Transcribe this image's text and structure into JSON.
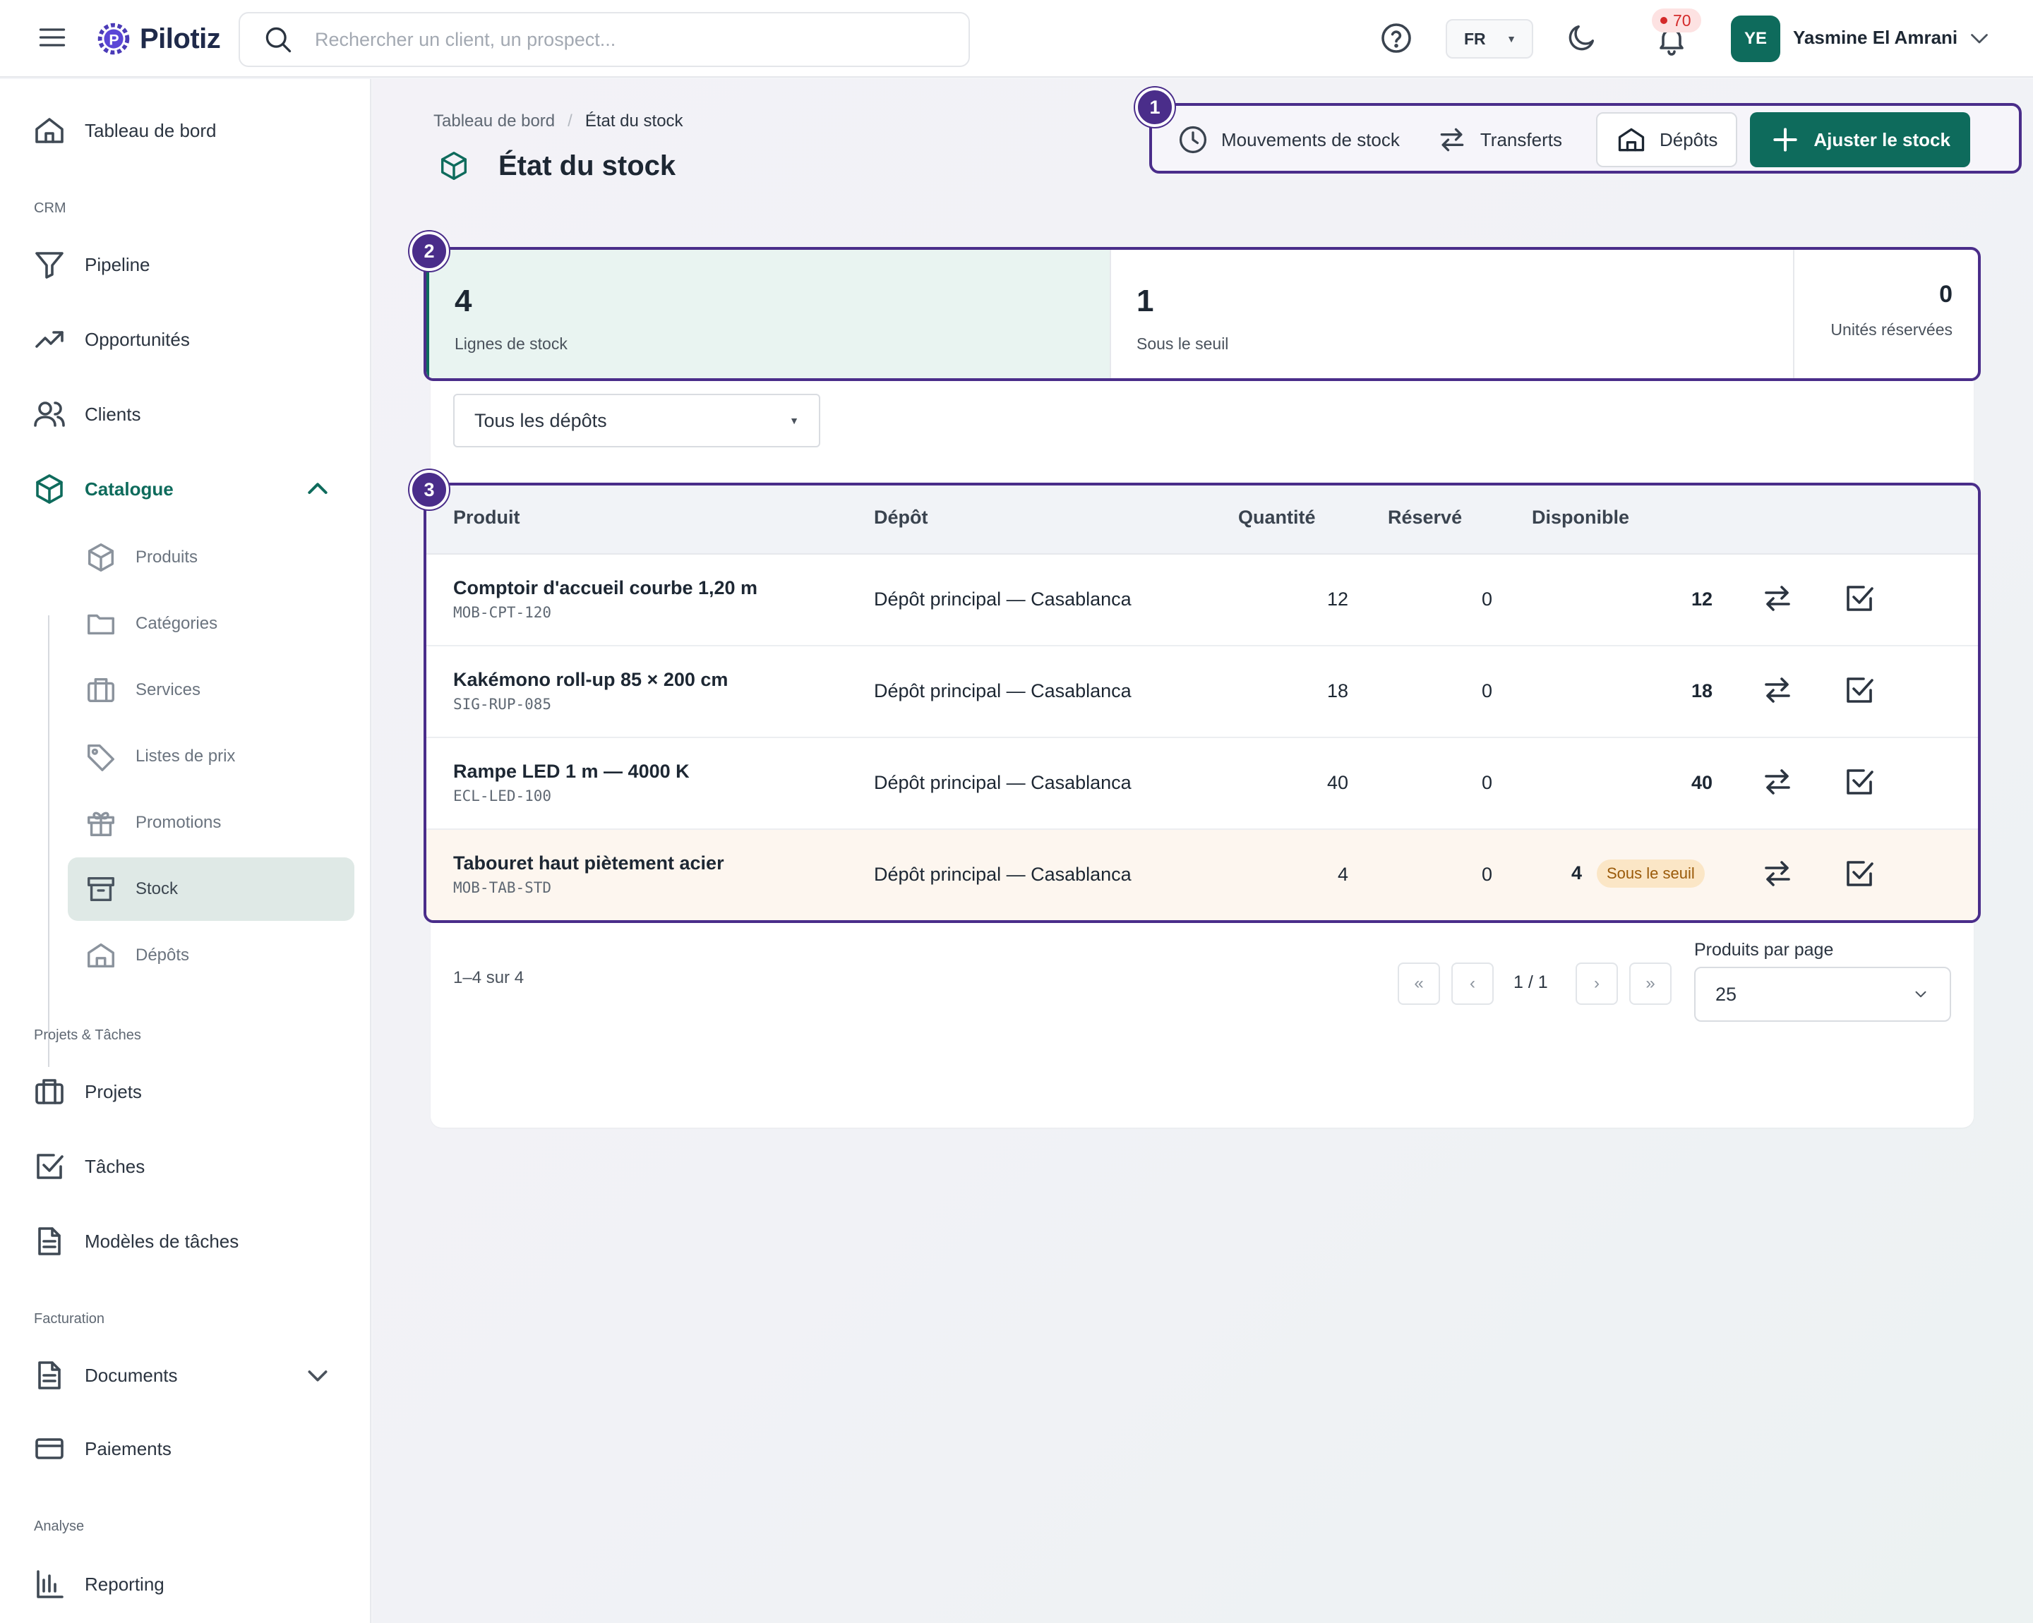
{
  "header": {
    "app_name": "Pilotiz",
    "search_placeholder": "Rechercher un client, un prospect...",
    "language": "FR",
    "notifications_count": "70",
    "user_initials": "YE",
    "user_name": "Yasmine El Amrani"
  },
  "sidebar": {
    "dashboard": "Tableau de bord",
    "sections": {
      "crm": "CRM",
      "projects": "Projets & Tâches",
      "billing": "Facturation",
      "analysis": "Analyse"
    },
    "crm_items": [
      "Pipeline",
      "Opportunités",
      "Clients"
    ],
    "catalogue": "Catalogue",
    "catalogue_items": [
      "Produits",
      "Catégories",
      "Services",
      "Listes de prix",
      "Promotions",
      "Stock",
      "Dépôts"
    ],
    "project_items": [
      "Projets",
      "Tâches",
      "Modèles de tâches"
    ],
    "billing_items": [
      "Documents",
      "Paiements"
    ],
    "analysis_items": [
      "Reporting"
    ]
  },
  "page": {
    "breadcrumb": [
      "Tableau de bord",
      "État du stock"
    ],
    "title": "État du stock"
  },
  "toolbar": {
    "movements": "Mouvements de stock",
    "transfers": "Transferts",
    "depots": "Dépôts",
    "adjust": "Ajuster le stock"
  },
  "markers": [
    "1",
    "2",
    "3"
  ],
  "stats": [
    {
      "value": "4",
      "label": "Lignes de stock"
    },
    {
      "value": "1",
      "label": "Sous le seuil"
    },
    {
      "value": "0",
      "label": "Unités réservées"
    }
  ],
  "filter": {
    "depot": "Tous les dépôts"
  },
  "table": {
    "columns": [
      "Produit",
      "Dépôt",
      "Quantité",
      "Réservé",
      "Disponible"
    ],
    "rows": [
      {
        "name": "Comptoir d'accueil courbe 1,20 m",
        "sku": "MOB-CPT-120",
        "depot": "Dépôt principal — Casablanca",
        "quantity": "12",
        "reserved": "0",
        "available": "12",
        "badge": ""
      },
      {
        "name": "Kakémono roll-up 85 × 200 cm",
        "sku": "SIG-RUP-085",
        "depot": "Dépôt principal — Casablanca",
        "quantity": "18",
        "reserved": "0",
        "available": "18",
        "badge": ""
      },
      {
        "name": "Rampe LED 1 m — 4000 K",
        "sku": "ECL-LED-100",
        "depot": "Dépôt principal — Casablanca",
        "quantity": "40",
        "reserved": "0",
        "available": "40",
        "badge": ""
      },
      {
        "name": "Tabouret haut piètement acier",
        "sku": "MOB-TAB-STD",
        "depot": "Dépôt principal — Casablanca",
        "quantity": "4",
        "reserved": "0",
        "available": "4",
        "badge": "Sous le seuil"
      }
    ]
  },
  "pagination": {
    "summary": "1–4 sur 4",
    "page": "1 / 1",
    "per_page_label": "Produits par page",
    "per_page": "25",
    "first": "«",
    "prev": "‹",
    "next": "›",
    "last": "»"
  },
  "colors": {
    "brand": "#0e6b5c",
    "annotation": "#4a2d8a",
    "warning_bg": "#fbe6c6",
    "notification": "#d42b2b"
  }
}
